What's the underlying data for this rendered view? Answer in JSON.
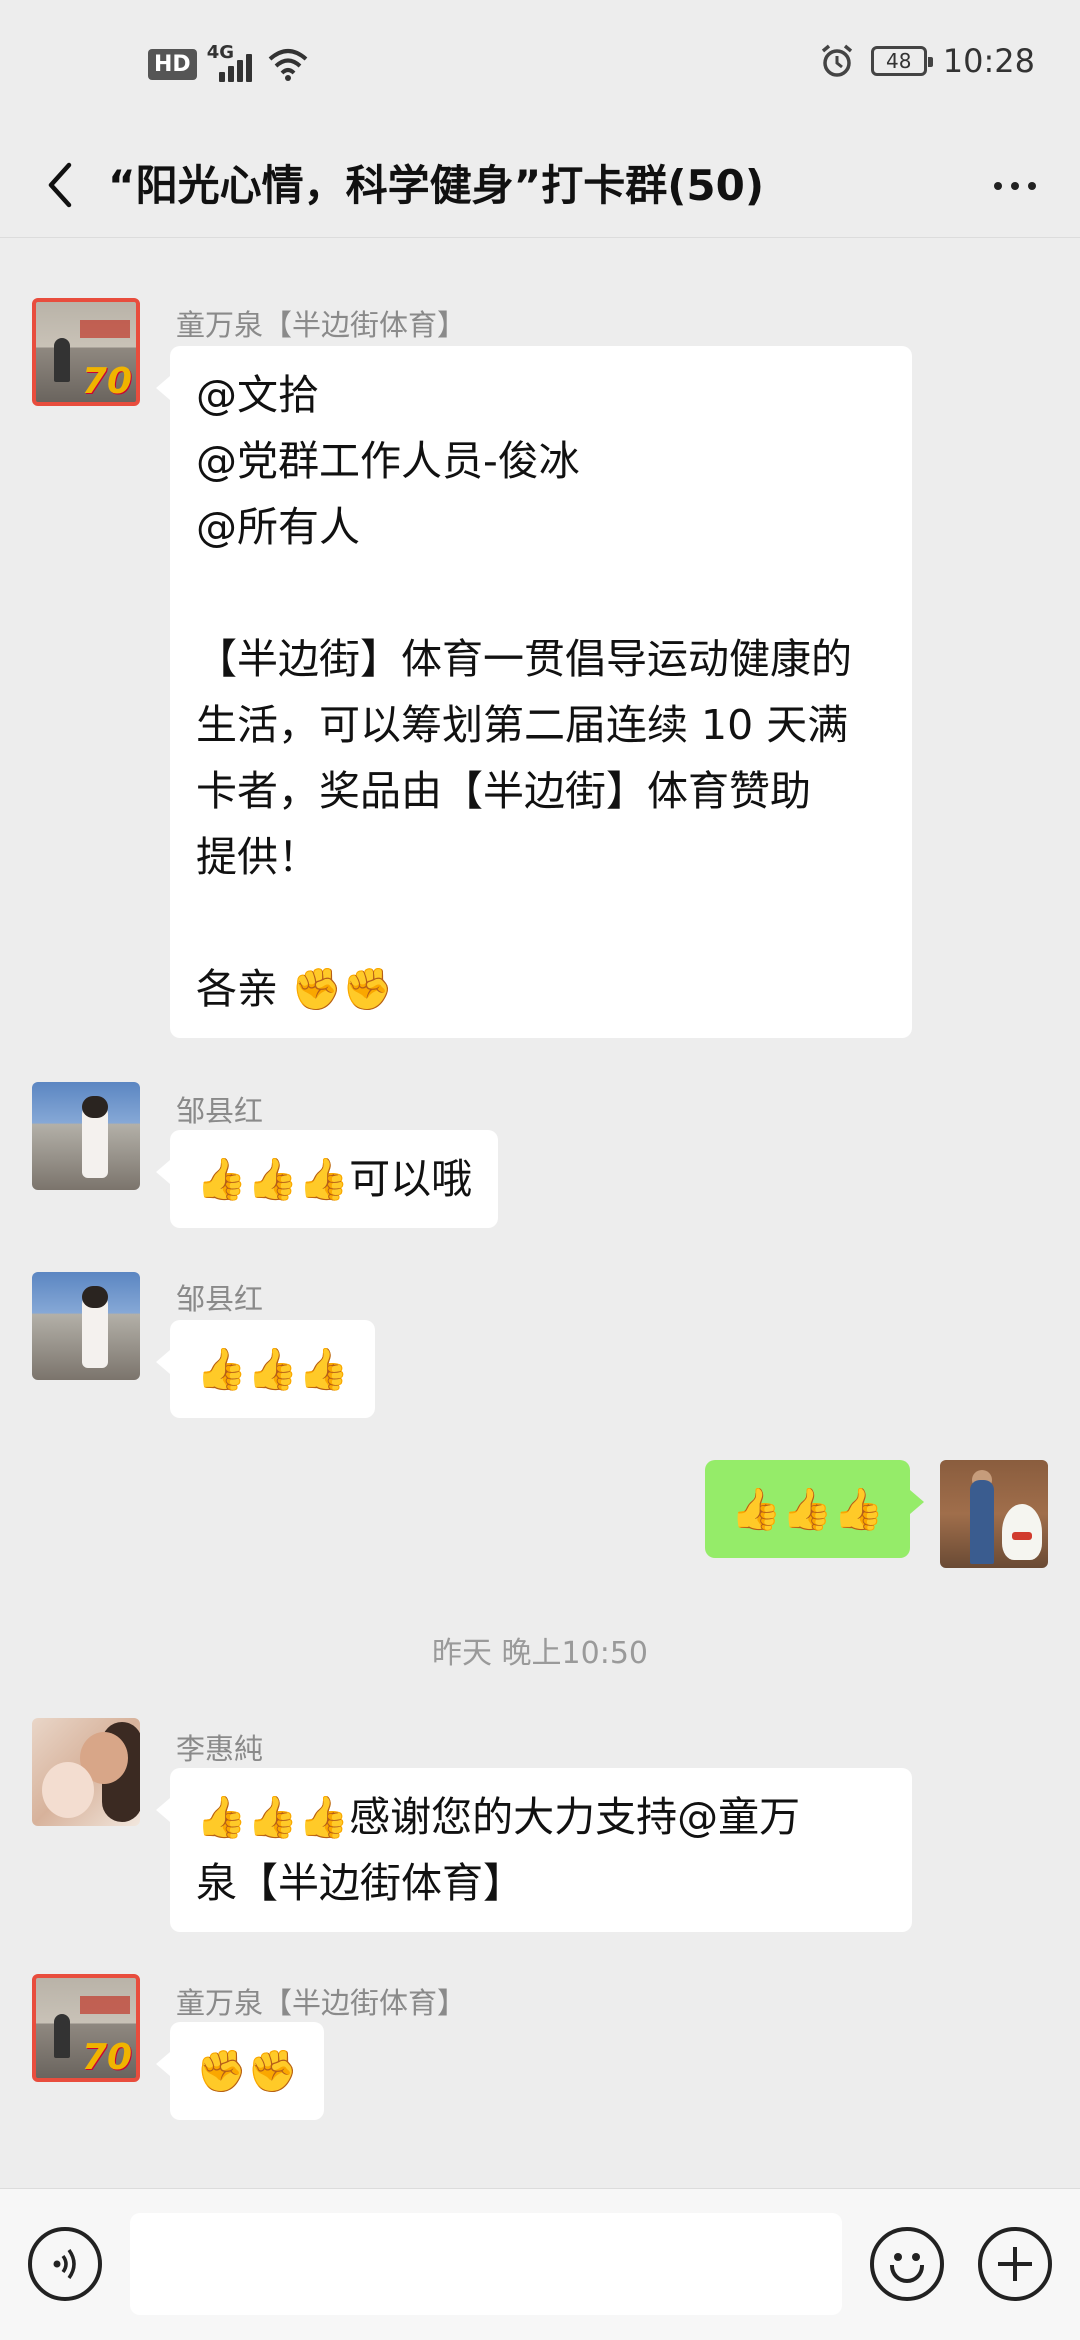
{
  "status_bar": {
    "hd": "HD",
    "network": "4G",
    "battery": "48",
    "time": "10:28"
  },
  "header": {
    "title": "“阳光心情，科学健身”打卡群(50)"
  },
  "messages": [
    {
      "sender": "童万泉【半边街体育】",
      "lines": [
        "@文拾",
        "@党群工作人员-俊冰",
        "@所有人",
        "",
        "【半边街】体育一贯倡导运动健康的",
        "生活，可以筹划第二届连续 10 天满",
        "卡者，奖品由【半边街】体育赞助",
        "提供！",
        "",
        "各亲 ✊✊"
      ]
    },
    {
      "sender": "邹县红",
      "text": "👍👍👍可以哦"
    },
    {
      "sender": "邹县红",
      "text": "👍👍👍"
    },
    {
      "sender": "",
      "text": "👍👍👍"
    },
    {
      "sender": "李惠純",
      "lines": [
        "👍👍👍感谢您的大力支持@童万",
        "泉【半边街体育】"
      ]
    },
    {
      "sender": "童万泉【半边街体育】",
      "text": "✊✊"
    }
  ],
  "time_divider": "昨天 晚上10:50",
  "input": {
    "placeholder": ""
  },
  "icons": {
    "back": "chevron-left-icon",
    "more": "more-dots-icon",
    "voice": "voice-icon",
    "emoji": "emoji-icon",
    "plus": "plus-icon"
  },
  "colors": {
    "background": "#ededed",
    "bubble_self": "#95ec69",
    "bubble_other": "#ffffff",
    "avatar_border": "#e84d3d"
  }
}
